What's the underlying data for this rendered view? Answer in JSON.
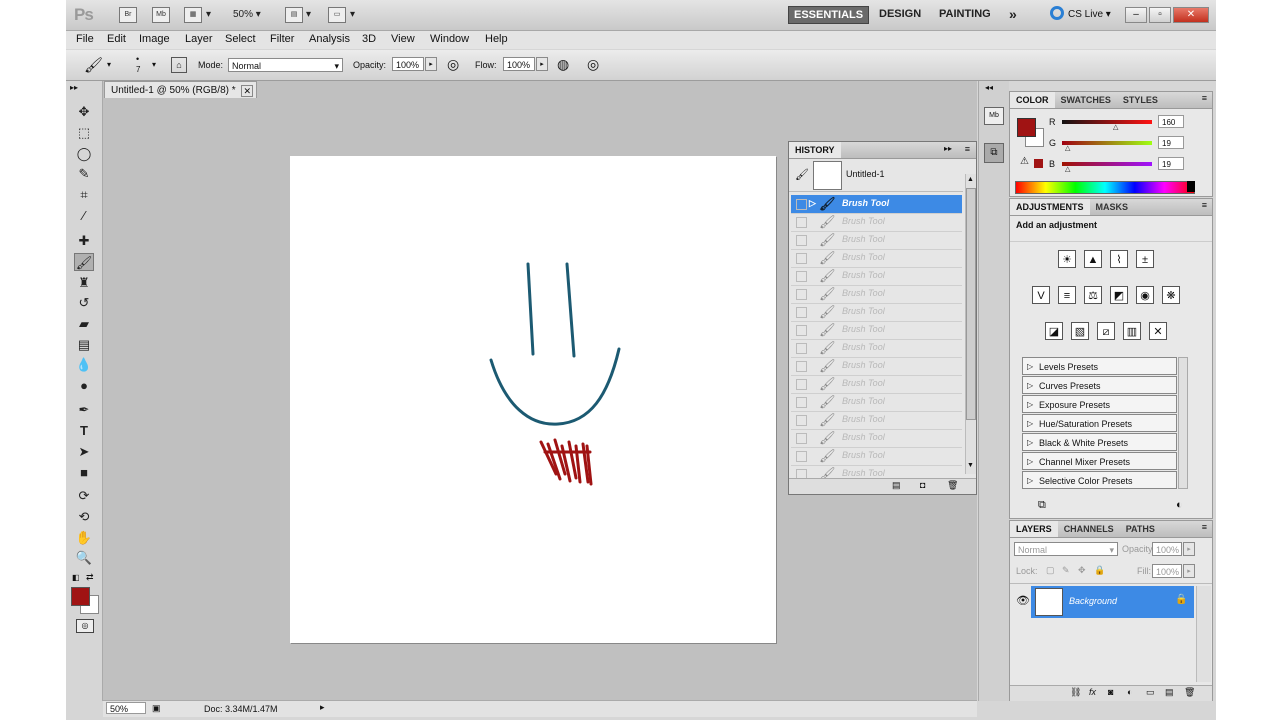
{
  "app": {
    "logo": "Ps",
    "br_button": "Br",
    "mb_button": "Mb",
    "zoom": "50%",
    "workspaces": [
      "ESSENTIALS",
      "DESIGN",
      "PAINTING"
    ],
    "more_glyph": "»",
    "cs_live": "CS Live"
  },
  "menu": [
    "File",
    "Edit",
    "Image",
    "Layer",
    "Select",
    "Filter",
    "Analysis",
    "3D",
    "View",
    "Window",
    "Help"
  ],
  "options": {
    "brush_size": "7",
    "mode_label": "Mode:",
    "mode_value": "Normal",
    "opacity_label": "Opacity:",
    "opacity_value": "100%",
    "flow_label": "Flow:",
    "flow_value": "100%"
  },
  "document": {
    "tab_title": "Untitled-1 @ 50% (RGB/8) *",
    "status_zoom": "50%",
    "status_doc": "Doc: 3.34M/1.47M"
  },
  "history": {
    "title": "HISTORY",
    "snapshot": "Untitled-1",
    "entries": [
      "Brush Tool",
      "Brush Tool",
      "Brush Tool",
      "Brush Tool",
      "Brush Tool",
      "Brush Tool",
      "Brush Tool",
      "Brush Tool",
      "Brush Tool",
      "Brush Tool",
      "Brush Tool",
      "Brush Tool",
      "Brush Tool",
      "Brush Tool",
      "Brush Tool",
      "Brush Tool"
    ],
    "selected_index": 0
  },
  "color_panel": {
    "tabs": [
      "COLOR",
      "SWATCHES",
      "STYLES"
    ],
    "channels": [
      {
        "label": "R",
        "value": "160"
      },
      {
        "label": "G",
        "value": "19"
      },
      {
        "label": "B",
        "value": "19"
      }
    ],
    "foreground": "#a01313"
  },
  "adjustments": {
    "tabs": [
      "ADJUSTMENTS",
      "MASKS"
    ],
    "heading": "Add an adjustment",
    "presets": [
      "Levels Presets",
      "Curves Presets",
      "Exposure Presets",
      "Hue/Saturation Presets",
      "Black & White Presets",
      "Channel Mixer Presets",
      "Selective Color Presets"
    ]
  },
  "layers": {
    "tabs": [
      "LAYERS",
      "CHANNELS",
      "PATHS"
    ],
    "blend_mode": "Normal",
    "opacity_label": "Opacity:",
    "opacity_value": "100%",
    "lock_label": "Lock:",
    "fill_label": "Fill:",
    "fill_value": "100%",
    "layer_name": "Background"
  },
  "colors": {
    "accent_selection": "#3d8ae5",
    "stroke_teal": "#1c5a72",
    "stroke_red": "#a01313"
  }
}
